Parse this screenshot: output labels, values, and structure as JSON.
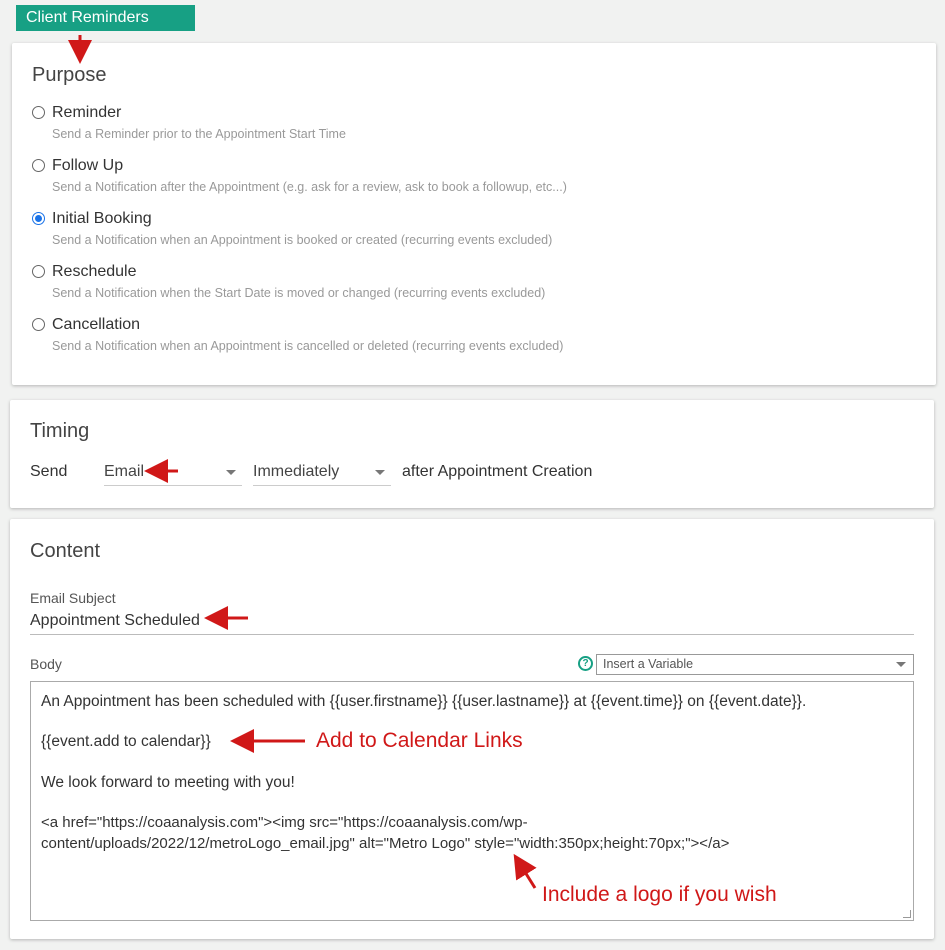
{
  "tab": {
    "label": "Client Reminders"
  },
  "purpose": {
    "title": "Purpose",
    "options": [
      {
        "label": "Reminder",
        "desc": "Send a Reminder prior to the Appointment Start Time",
        "checked": false
      },
      {
        "label": "Follow Up",
        "desc": "Send a Notification after the Appointment (e.g. ask for a review, ask to book a followup, etc...)",
        "checked": false
      },
      {
        "label": "Initial Booking",
        "desc": "Send a Notification when an Appointment is booked or created (recurring events excluded)",
        "checked": true
      },
      {
        "label": "Reschedule",
        "desc": "Send a Notification when the Start Date is moved or changed (recurring events excluded)",
        "checked": false
      },
      {
        "label": "Cancellation",
        "desc": "Send a Notification when an Appointment is cancelled or deleted (recurring events excluded)",
        "checked": false
      }
    ]
  },
  "timing": {
    "title": "Timing",
    "send_label": "Send",
    "method_value": "Email",
    "when_value": "Immediately",
    "suffix": "after Appointment Creation"
  },
  "content": {
    "title": "Content",
    "subject_label": "Email Subject",
    "subject_value": "Appointment Scheduled",
    "body_label": "Body",
    "variable_placeholder": "Insert a Variable",
    "body_lines": [
      "An Appointment has been scheduled with {{user.firstname}} {{user.lastname}} at {{event.time}} on {{event.date}}.",
      "{{event.add  to  calendar}}",
      "We look forward to meeting with you!",
      "<a href=\"https://coaanalysis.com\"><img src=\"https://coaanalysis.com/wp-",
      "content/uploads/2022/12/metroLogo_email.jpg\" alt=\"Metro Logo\" style=\"width:350px;height:70px;\"></a>"
    ]
  },
  "annotations": {
    "calendar": "Add to Calendar Links",
    "logo": "Include a logo if you wish"
  },
  "colors": {
    "accent": "#17a084",
    "annotation": "#d01818",
    "radio_checked": "#1a73e8"
  }
}
